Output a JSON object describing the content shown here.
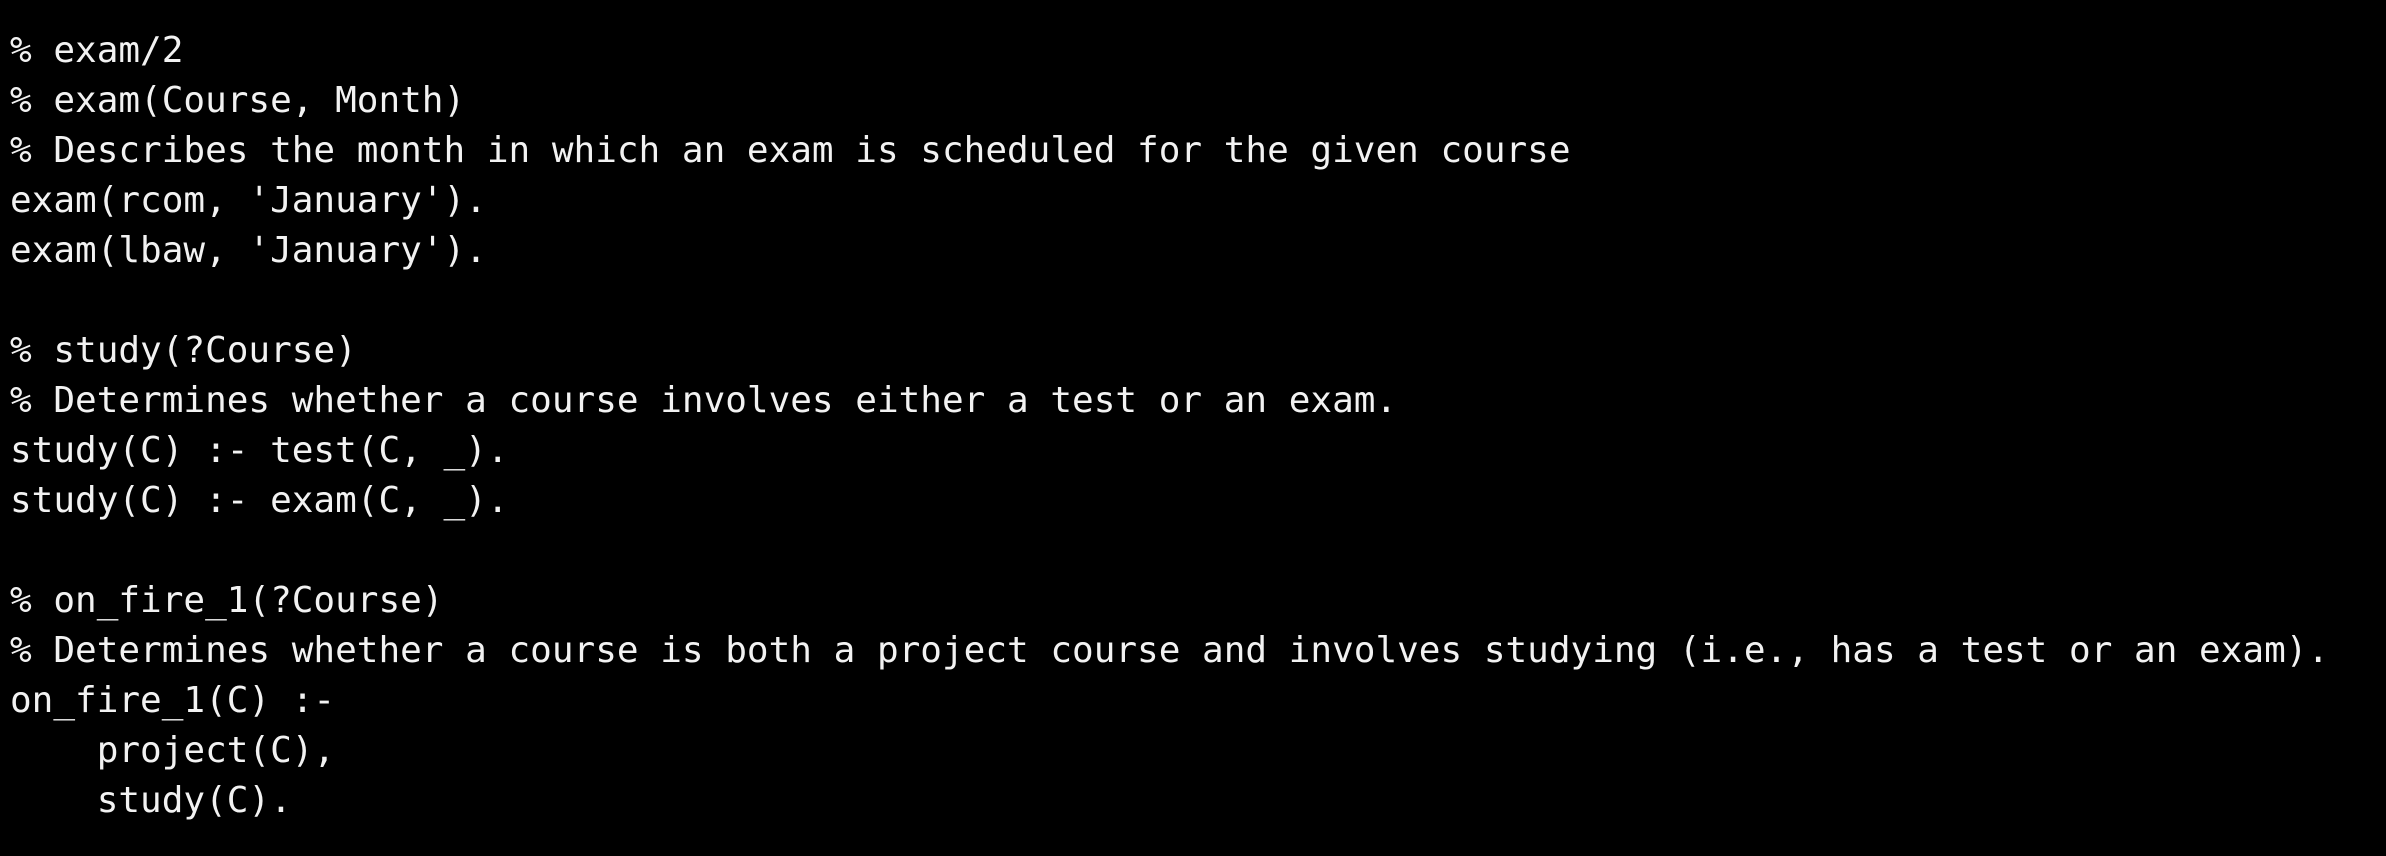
{
  "editor": {
    "lines": [
      "% exam/2",
      "% exam(Course, Month)",
      "% Describes the month in which an exam is scheduled for the given course",
      "exam(rcom, 'January').",
      "exam(lbaw, 'January').",
      "",
      "% study(?Course)",
      "% Determines whether a course involves either a test or an exam.",
      "study(C) :- test(C, _).",
      "study(C) :- exam(C, _).",
      "",
      "% on_fire_1(?Course)",
      "% Determines whether a course is both a project course and involves studying (i.e., has a test or an exam).",
      "on_fire_1(C) :-",
      "    project(C),",
      "    study(C)."
    ]
  }
}
